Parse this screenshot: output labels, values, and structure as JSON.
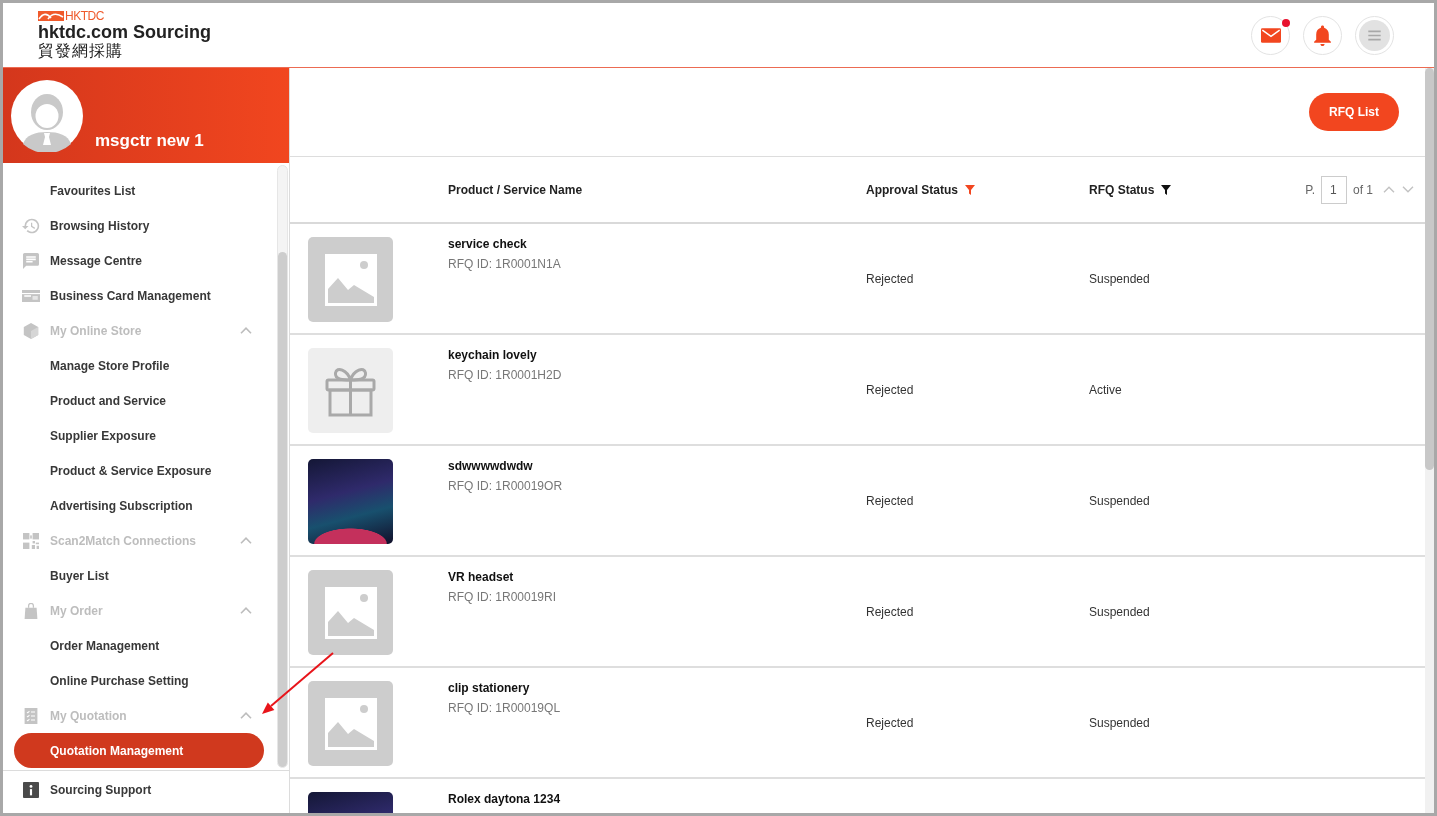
{
  "header": {
    "logo": {
      "brand": "HKTDC",
      "title": "hktdc.com Sourcing",
      "subtitle": "貿發網採購"
    },
    "actions": [
      {
        "badge": true
      },
      {
        "badge": false
      },
      {
        "badge": false
      }
    ]
  },
  "profile": {
    "name": "msgctr new 1"
  },
  "sidebar": {
    "items": [
      {
        "kind": "link",
        "label": "Favourites List",
        "selected": false
      },
      {
        "kind": "link",
        "label": "Browsing History",
        "selected": false
      },
      {
        "kind": "link",
        "label": "Message Centre",
        "selected": false
      },
      {
        "kind": "link",
        "label": "Business Card Management",
        "selected": false
      },
      {
        "kind": "group",
        "label": "My Online Store",
        "expanded": true,
        "children": [
          {
            "label": "Manage Store Profile",
            "selected": false
          },
          {
            "label": "Product and Service",
            "selected": false
          },
          {
            "label": "Supplier Exposure",
            "selected": false
          },
          {
            "label": "Product & Service Exposure",
            "selected": false
          },
          {
            "label": "Advertising Subscription",
            "selected": false
          }
        ]
      },
      {
        "kind": "group",
        "label": "Scan2Match Connections",
        "expanded": true,
        "children": [
          {
            "label": "Buyer List",
            "selected": false
          }
        ]
      },
      {
        "kind": "group",
        "label": "My Order",
        "expanded": true,
        "children": [
          {
            "label": "Order Management",
            "selected": false
          },
          {
            "label": "Online Purchase Setting",
            "selected": false
          }
        ]
      },
      {
        "kind": "group",
        "label": "My Quotation",
        "expanded": true,
        "children": [
          {
            "label": "Quotation Management",
            "selected": true
          }
        ]
      }
    ],
    "footer": [
      {
        "label": "Sourcing Support",
        "selected": false
      }
    ]
  },
  "toolbar": {
    "rfq_list_button": "RFQ List"
  },
  "table": {
    "columns": [
      {
        "label": "Product / Service Name"
      },
      {
        "label": "Approval Status",
        "filter": {
          "active": true
        }
      },
      {
        "label": "RFQ Status",
        "filter": {
          "active": false
        }
      }
    ],
    "pagination": {
      "prefix": "P.",
      "page": "1",
      "suffix": "of 1"
    },
    "rows": [
      {
        "thumbnail": {
          "kind": "placeholder"
        },
        "name": "service check",
        "rfq_id": "RFQ ID: 1R0001N1A",
        "approval_status": "Rejected",
        "rfq_status": "Suspended"
      },
      {
        "thumbnail": {
          "kind": "gift"
        },
        "name": "keychain lovely",
        "rfq_id": "RFQ ID: 1R0001H2D",
        "approval_status": "Rejected",
        "rfq_status": "Active"
      },
      {
        "thumbnail": {
          "kind": "photo"
        },
        "name": "sdwwwwdwdw",
        "rfq_id": "RFQ ID: 1R00019OR",
        "approval_status": "Rejected",
        "rfq_status": "Suspended"
      },
      {
        "thumbnail": {
          "kind": "placeholder"
        },
        "name": "VR headset",
        "rfq_id": "RFQ ID: 1R00019RI",
        "approval_status": "Rejected",
        "rfq_status": "Suspended"
      },
      {
        "thumbnail": {
          "kind": "placeholder"
        },
        "name": "clip stationery",
        "rfq_id": "RFQ ID: 1R00019QL",
        "approval_status": "Rejected",
        "rfq_status": "Suspended"
      },
      {
        "thumbnail": {
          "kind": "photo"
        },
        "name": "Rolex daytona 1234"
      }
    ]
  }
}
